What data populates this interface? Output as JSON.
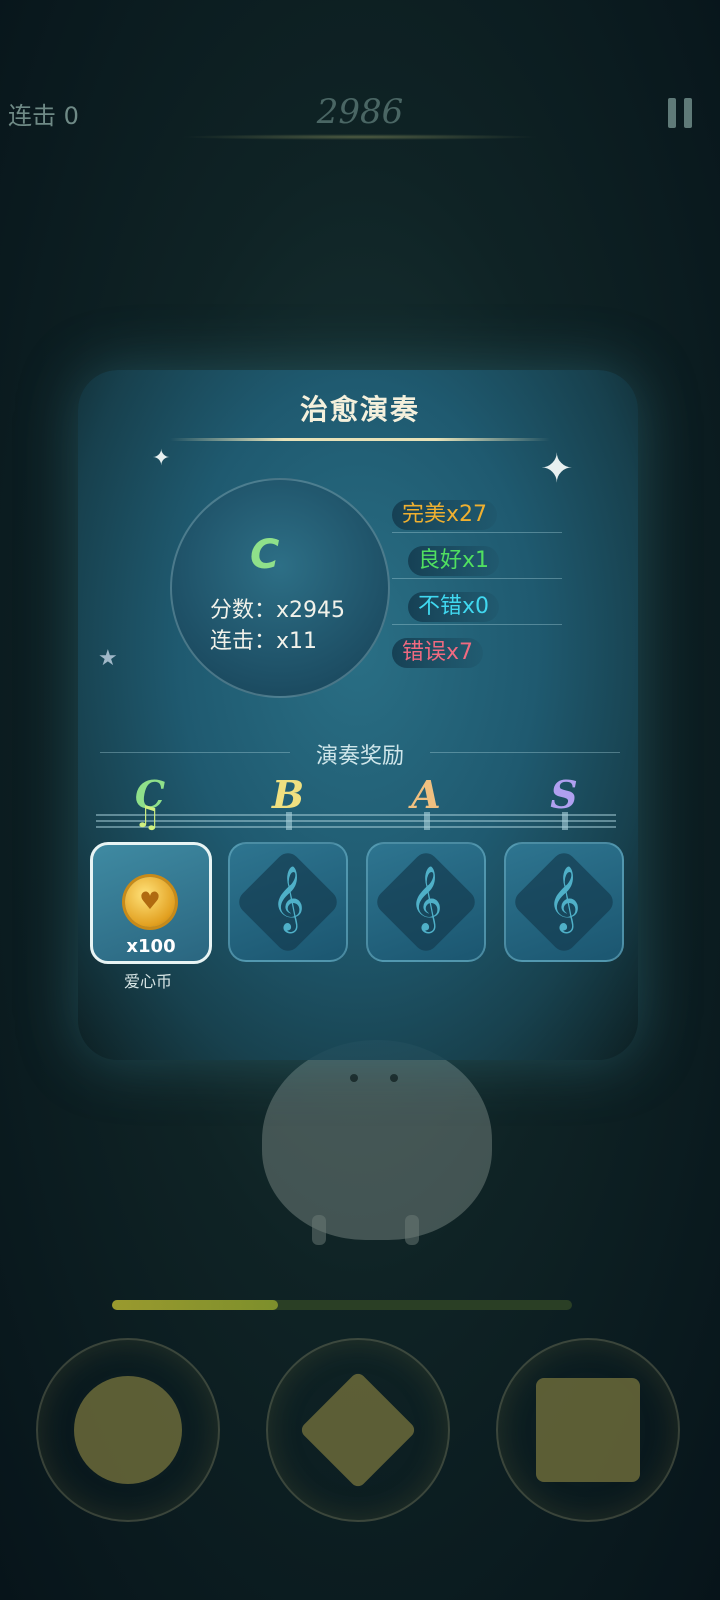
{
  "hud": {
    "combo": "连击 0",
    "score": "2986"
  },
  "panel": {
    "title": "治愈演奏",
    "grade": "C",
    "score_label": "分数：x2945",
    "combo_label": "连击：x11",
    "judgements": {
      "perfect": "完美x27",
      "good": "良好x1",
      "ok": "不错x0",
      "miss": "错误x7"
    },
    "reward_title": "演奏奖励",
    "ranks": [
      "C",
      "B",
      "A",
      "S"
    ],
    "rewards": [
      {
        "rank": "C",
        "name": "爱心币",
        "qty": "x100",
        "unlocked": true
      },
      {
        "rank": "B",
        "locked_icon": "treble-clef-icon",
        "unlocked": false
      },
      {
        "rank": "A",
        "locked_icon": "treble-clef-icon",
        "unlocked": false
      },
      {
        "rank": "S",
        "locked_icon": "treble-clef-icon",
        "unlocked": false
      }
    ]
  },
  "progress": {
    "fraction": 0.36
  },
  "colors": {
    "perfect": "#f0b030",
    "good": "#50e060",
    "ok": "#40d8f0",
    "miss": "#f06a80",
    "rank_c": "#8fe08a"
  }
}
